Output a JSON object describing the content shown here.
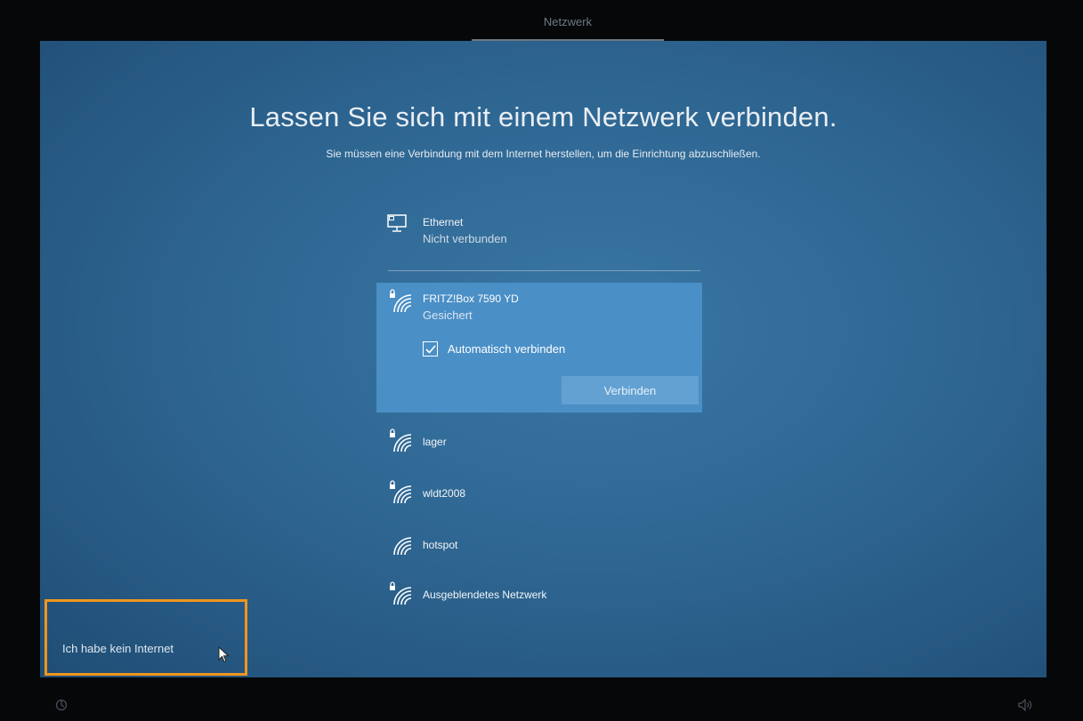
{
  "top_bar": {
    "tab_label": "Netzwerk"
  },
  "header": {
    "title": "Lassen Sie sich mit einem Netzwerk verbinden.",
    "subtitle": "Sie müssen eine Verbindung mit dem Internet herstellen, um die Einrichtung abzuschließen."
  },
  "ethernet": {
    "name": "Ethernet",
    "status": "Nicht verbunden",
    "icon": "ethernet-monitor-icon"
  },
  "selected_network": {
    "name": "FRITZ!Box 7590 YD",
    "status": "Gesichert",
    "auto_connect_label": "Automatisch verbinden",
    "auto_connect_checked": true,
    "connect_button": "Verbinden",
    "icon": "wifi-secured-icon"
  },
  "networks": [
    {
      "name": "lager",
      "secured": true
    },
    {
      "name": "wldt2008",
      "secured": true
    },
    {
      "name": "hotspot",
      "secured": false
    },
    {
      "name": "Ausgeblendetes Netzwerk",
      "secured": true
    }
  ],
  "footer": {
    "no_internet_link": "Ich habe kein Internet"
  },
  "colors": {
    "background": "#2f6793",
    "selected_item": "#4a8fc6",
    "button": "#63a1d2",
    "highlight_box": "#f0951e"
  }
}
